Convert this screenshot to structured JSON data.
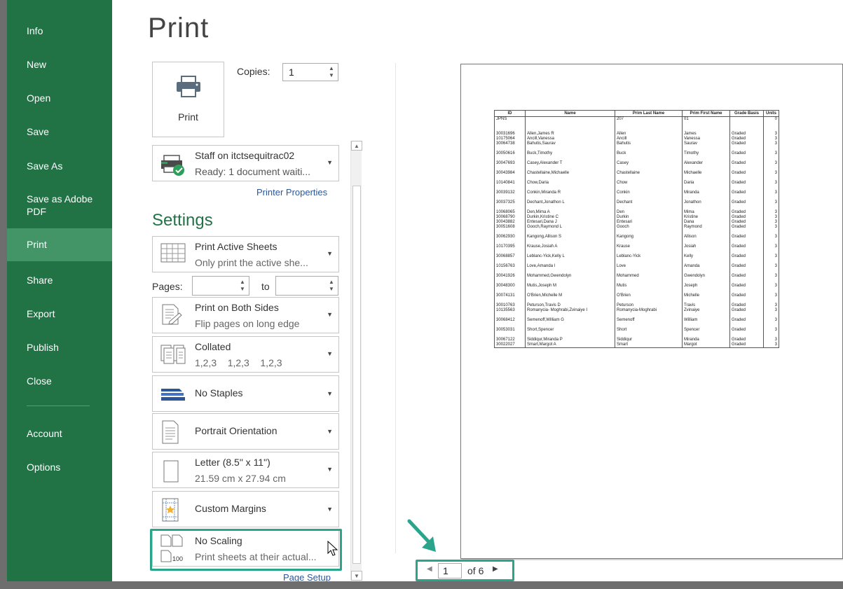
{
  "sidebar": {
    "items": [
      {
        "label": "Info"
      },
      {
        "label": "New"
      },
      {
        "label": "Open"
      },
      {
        "label": "Save"
      },
      {
        "label": "Save As"
      },
      {
        "label": "Save as Adobe PDF"
      },
      {
        "label": "Print"
      },
      {
        "label": "Share"
      },
      {
        "label": "Export"
      },
      {
        "label": "Publish"
      },
      {
        "label": "Close"
      },
      {
        "label": "Account"
      },
      {
        "label": "Options"
      }
    ],
    "active": "Print"
  },
  "page_title": "Print",
  "print_button": {
    "label": "Print"
  },
  "copies": {
    "label": "Copies:",
    "value": "1"
  },
  "printer": {
    "name": "Staff on itctsequitrac02",
    "status": "Ready: 1 document waiti...",
    "properties_link": "Printer Properties"
  },
  "settings": {
    "heading": "Settings",
    "sheets": {
      "title": "Print Active Sheets",
      "subtitle": "Only print the active she..."
    },
    "pages": {
      "label": "Pages:",
      "to_label": "to",
      "from_value": "",
      "to_value": ""
    },
    "sides": {
      "title": "Print on Both Sides",
      "subtitle": "Flip pages on long edge"
    },
    "collation": {
      "title": "Collated",
      "subtitle": "1,2,3    1,2,3    1,2,3"
    },
    "staples": {
      "title": "No Staples"
    },
    "orientation": {
      "title": "Portrait Orientation"
    },
    "paper": {
      "title": "Letter (8.5\" x 11\")",
      "subtitle": "21.59 cm x 27.94 cm"
    },
    "margins": {
      "title": "Custom Margins"
    },
    "scaling": {
      "title": "No Scaling",
      "subtitle": "Print sheets at their actual...",
      "icon_text": "100"
    },
    "page_setup_link": "Page Setup"
  },
  "pager": {
    "current": "1",
    "of_text": "of 6"
  },
  "colors": {
    "sidebar": "#217346",
    "sidebar_active": "#439467",
    "accent": "#217346",
    "highlight": "#2aa58c",
    "link": "#2b579a"
  },
  "preview_table": {
    "headers": [
      "ID",
      "Name",
      "Prim Last Name",
      "Prim First Name",
      "Grade Basis",
      "Units"
    ],
    "rows": [
      {
        "id": "JPNS",
        "name": "",
        "last": "207",
        "first": "01",
        "grade": "",
        "units": "0",
        "gap": 0
      },
      {
        "id": "30031696",
        "name": "Allen,James R",
        "last": "Allen",
        "first": "James",
        "grade": "Graded",
        "units": "3",
        "gap": 2
      },
      {
        "id": "10175064",
        "name": "Ancill,Vanessa",
        "last": "Ancill",
        "first": "Vanessa",
        "grade": "Graded",
        "units": "3",
        "gap": 0
      },
      {
        "id": "30064738",
        "name": "Bahutis,Saurav",
        "last": "Bahutis",
        "first": "Saurav",
        "grade": "Graded",
        "units": "3",
        "gap": 0
      },
      {
        "id": "30050616",
        "name": "Buck,Timothy",
        "last": "Buck",
        "first": "Timothy",
        "grade": "Graded",
        "units": "3",
        "gap": 1
      },
      {
        "id": "30047693",
        "name": "Casey,Alexander T",
        "last": "Casey",
        "first": "Alexander",
        "grade": "Graded",
        "units": "3",
        "gap": 1
      },
      {
        "id": "30043984",
        "name": "Chastellaine,Michaelle",
        "last": "Chastellaine",
        "first": "Michaelle",
        "grade": "Graded",
        "units": "3",
        "gap": 1
      },
      {
        "id": "10140841",
        "name": "Chow,Daria",
        "last": "Chow",
        "first": "Daria",
        "grade": "Graded",
        "units": "3",
        "gap": 1
      },
      {
        "id": "30039132",
        "name": "Conkin,Miranda R",
        "last": "Conkin",
        "first": "Miranda",
        "grade": "Graded",
        "units": "3",
        "gap": 1
      },
      {
        "id": "30037325",
        "name": "Dechant,Jonathon L",
        "last": "Dechant",
        "first": "Jonathon",
        "grade": "Graded",
        "units": "3",
        "gap": 1
      },
      {
        "id": "10068065",
        "name": "Den,Mima A",
        "last": "Den",
        "first": "Mima",
        "grade": "Graded",
        "units": "3",
        "gap": 1
      },
      {
        "id": "30068790",
        "name": "Durkin,Kristine C",
        "last": "Durkin",
        "first": "Kristine",
        "grade": "Graded",
        "units": "3",
        "gap": 0
      },
      {
        "id": "30043882",
        "name": "Entesari,Dana J",
        "last": "Entesari",
        "first": "Dana",
        "grade": "Graded",
        "units": "3",
        "gap": 0
      },
      {
        "id": "30051608",
        "name": "Gooch,Raymond L",
        "last": "Gooch",
        "first": "Raymond",
        "grade": "Graded",
        "units": "3",
        "gap": 0
      },
      {
        "id": "30062930",
        "name": "Kangong,Allison S",
        "last": "Kangong",
        "first": "Allison",
        "grade": "Graded",
        "units": "3",
        "gap": 1
      },
      {
        "id": "10170395",
        "name": "Krause,Josiah A",
        "last": "Krause",
        "first": "Josiah",
        "grade": "Graded",
        "units": "3",
        "gap": 1
      },
      {
        "id": "30068857",
        "name": "Leblanc-Yick,Kelly L",
        "last": "Leblanc-Yick",
        "first": "Kelly",
        "grade": "Graded",
        "units": "3",
        "gap": 1
      },
      {
        "id": "10156763",
        "name": "Love,Amanda l",
        "last": "Love",
        "first": "Amanda",
        "grade": "Graded",
        "units": "3",
        "gap": 1
      },
      {
        "id": "30041926",
        "name": "Mohammed,Gwendolyn",
        "last": "Mohammed",
        "first": "Gwendolyn",
        "grade": "Graded",
        "units": "3",
        "gap": 1
      },
      {
        "id": "30048300",
        "name": "Mutis,Joseph M",
        "last": "Mutis",
        "first": "Joseph",
        "grade": "Graded",
        "units": "3",
        "gap": 1
      },
      {
        "id": "30074131",
        "name": "O'Brien,Michelle M",
        "last": "O'Brien",
        "first": "Michelle",
        "grade": "Graded",
        "units": "3",
        "gap": 1
      },
      {
        "id": "30010763",
        "name": "Peturson,Travis D",
        "last": "Peturson",
        "first": "Travis",
        "grade": "Graded",
        "units": "3",
        "gap": 1
      },
      {
        "id": "10135563",
        "name": "Romanycia- Moghrabi,Zvinaiye I",
        "last": "Romanycia-Moghrabi",
        "first": "Zvinaiye",
        "grade": "Graded",
        "units": "3",
        "gap": 0
      },
      {
        "id": "30068412",
        "name": "Semenoff,William G",
        "last": "Semenoff",
        "first": "William",
        "grade": "Graded",
        "units": "3",
        "gap": 1
      },
      {
        "id": "30053031",
        "name": "Short,Spencer",
        "last": "Short",
        "first": "Spencer",
        "grade": "Graded",
        "units": "3",
        "gap": 1
      },
      {
        "id": "30067122",
        "name": "Siddiqur,Miranda P",
        "last": "Siddiqur",
        "first": "Miranda",
        "grade": "Graded",
        "units": "3",
        "gap": 1
      },
      {
        "id": "30022027",
        "name": "Smart,Margot A",
        "last": "Smart",
        "first": "Margot",
        "grade": "Graded",
        "units": "3",
        "gap": 0
      }
    ]
  }
}
